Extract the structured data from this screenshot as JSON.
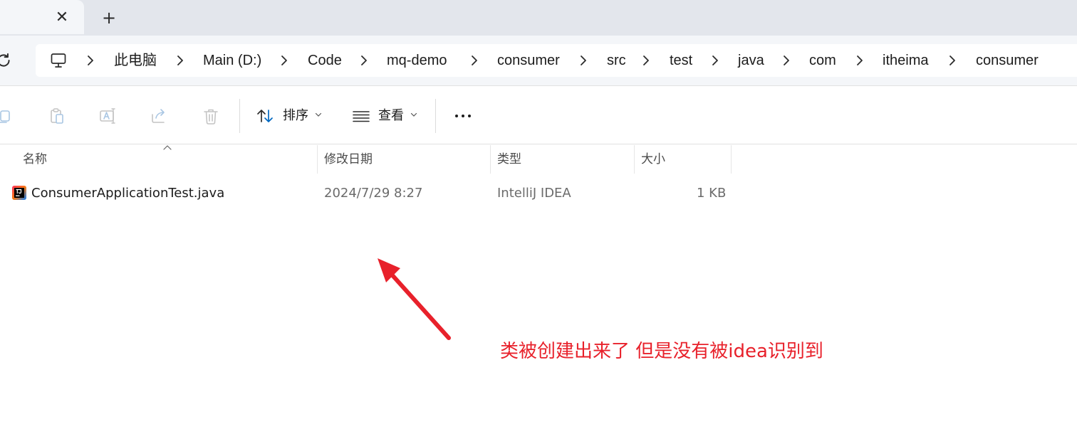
{
  "tabs": {
    "close_symbol": "✕",
    "new_tab_symbol": "+"
  },
  "breadcrumb": {
    "items": [
      "此电脑",
      "Main (D:)",
      "Code",
      "mq-demo",
      "consumer",
      "src",
      "test",
      "java",
      "com",
      "itheima",
      "consumer"
    ]
  },
  "commandbar": {
    "sort_label": "排序",
    "view_label": "查看"
  },
  "columns": {
    "name": "名称",
    "modified": "修改日期",
    "type": "类型",
    "size": "大小"
  },
  "files": [
    {
      "name": "ConsumerApplicationTest.java",
      "modified": "2024/7/29 8:27",
      "type": "IntelliJ IDEA",
      "size": "1 KB"
    }
  ],
  "annotation": {
    "text": "类被创建出来了 但是没有被idea识别到",
    "color": "#e8212b"
  },
  "colors": {
    "accent": "#0067c0",
    "annotation_red": "#e8212b"
  }
}
